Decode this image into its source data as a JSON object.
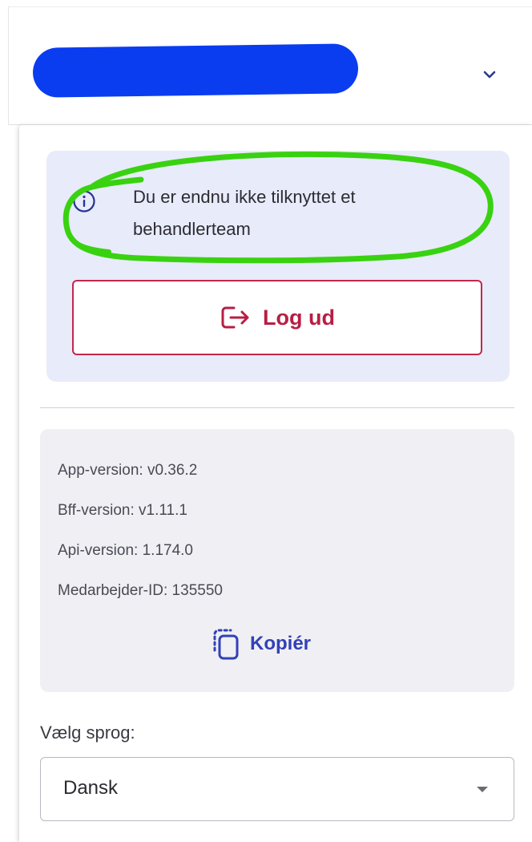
{
  "header": {
    "user_name_redacted": true,
    "redaction_color": "#0a3df0",
    "expand_icon": "chevron-down-icon"
  },
  "notice": {
    "icon": "info-circle-icon",
    "text": "Du er endnu ikke tilknyttet et behandlerteam",
    "background_color": "#e8ebfa",
    "highlight_color": "#39d211"
  },
  "logout": {
    "label": "Log ud",
    "icon": "logout-arrow-icon",
    "color": "#b81e44"
  },
  "versions": {
    "lines": [
      "App-version: v0.36.2",
      "Bff-version: v1.11.1",
      "Api-version: 1.174.0",
      "Medarbejder-ID: 135550"
    ],
    "copy_label": "Kopiér",
    "copy_icon": "copy-icon",
    "accent_color": "#3240b8"
  },
  "language": {
    "label": "Vælg sprog:",
    "selected": "Dansk",
    "dropdown_icon": "caret-down-icon"
  }
}
